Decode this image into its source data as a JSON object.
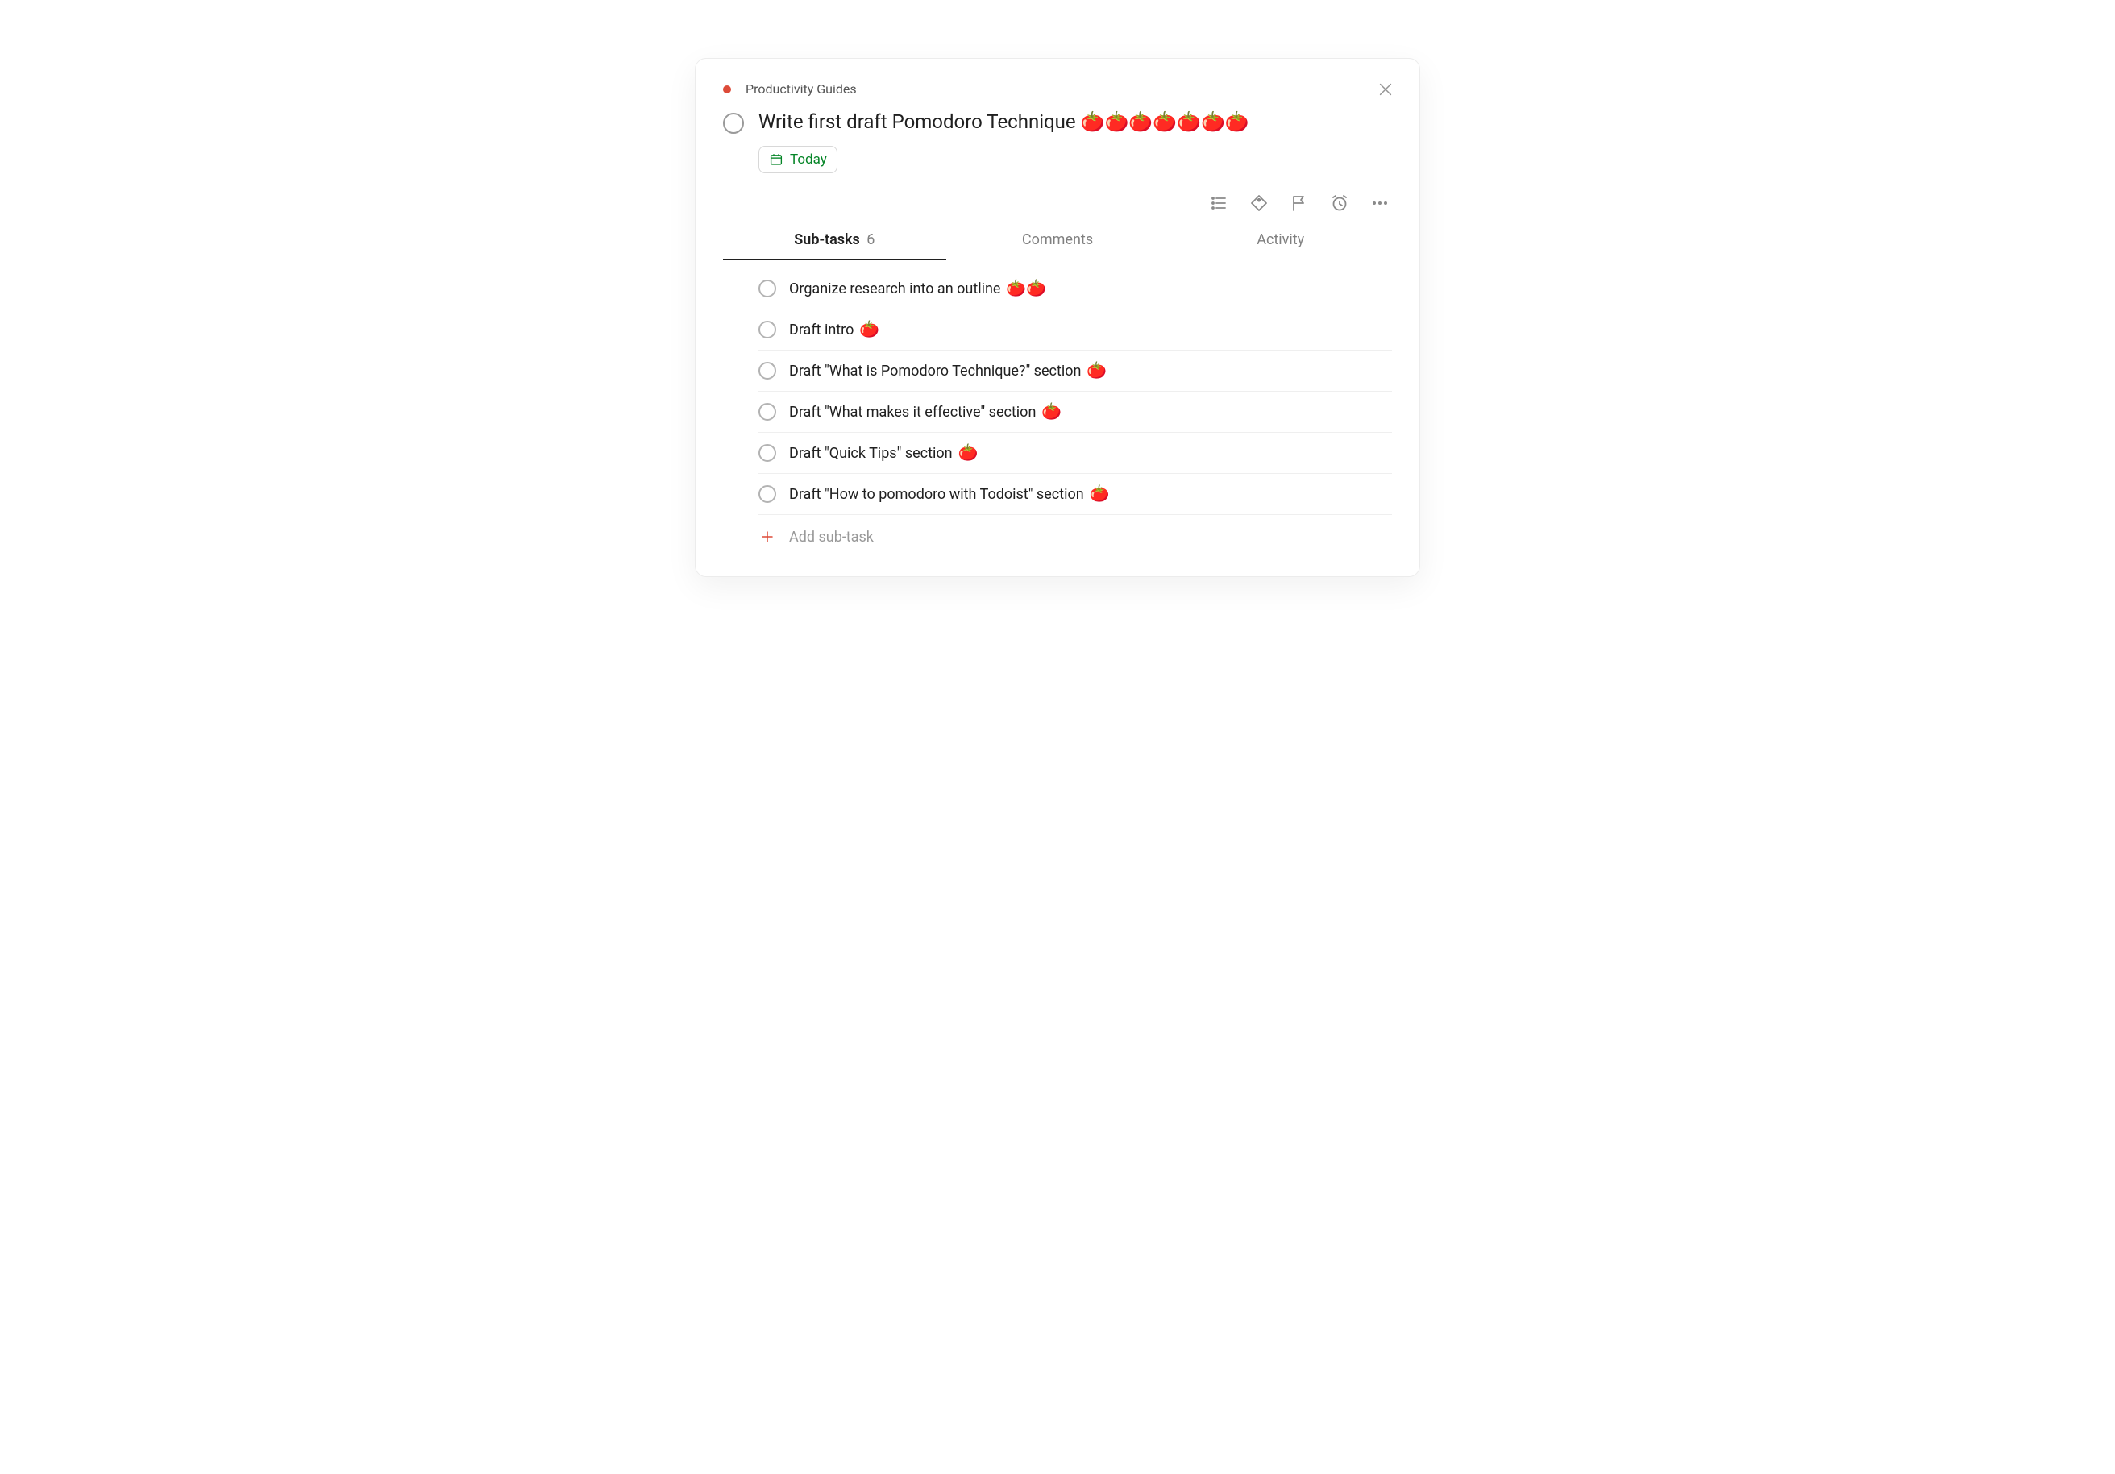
{
  "project": {
    "name": "Productivity Guides",
    "color": "#dd4b39"
  },
  "task": {
    "title": "Write first draft Pomodoro Technique",
    "tomato_count": 7,
    "tomato_emoji": "🍅",
    "due_label": "Today"
  },
  "tabs": {
    "subtasks": {
      "label": "Sub-tasks",
      "count": "6"
    },
    "comments": {
      "label": "Comments"
    },
    "activity": {
      "label": "Activity"
    }
  },
  "subtasks": [
    {
      "label": "Organize research into an outline",
      "tomato_count": 2
    },
    {
      "label": "Draft intro",
      "tomato_count": 1
    },
    {
      "label": "Draft \"What is Pomodoro Technique?\" section",
      "tomato_count": 1
    },
    {
      "label": "Draft \"What makes it effective\" section",
      "tomato_count": 1
    },
    {
      "label": "Draft \"Quick Tips\" section",
      "tomato_count": 1
    },
    {
      "label": "Draft \"How to pomodoro with Todoist\" section",
      "tomato_count": 1
    }
  ],
  "add_subtask_label": "Add sub-task",
  "colors": {
    "green": "#058527",
    "red": "#dd4b39"
  }
}
